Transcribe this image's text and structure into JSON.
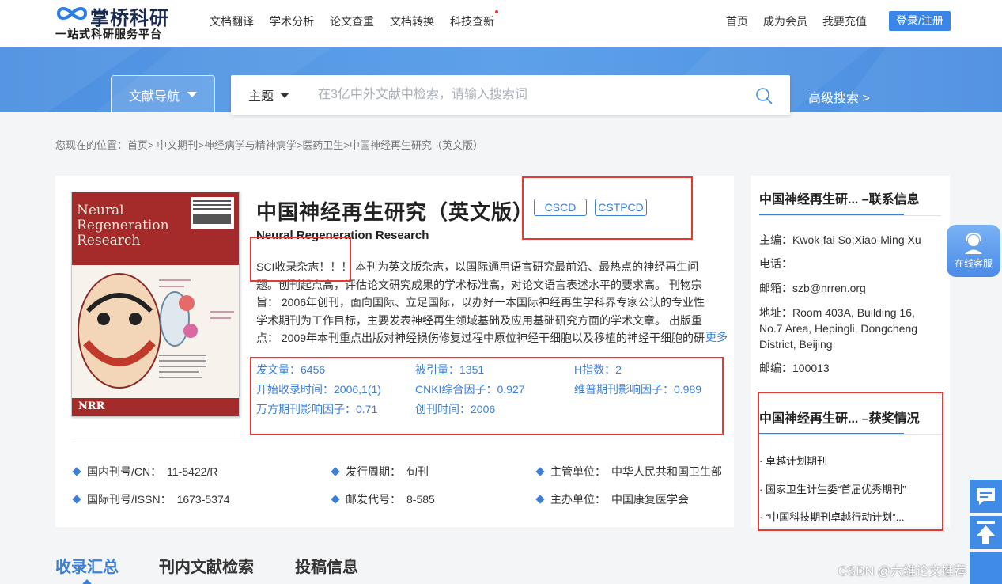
{
  "header": {
    "logo_name": "掌桥科研",
    "logo_slogan": "一站式科研服务平台",
    "nav": [
      "文档翻译",
      "学术分析",
      "论文查重",
      "文档转换",
      "科技查新"
    ],
    "right_nav": [
      "首页",
      "成为会员",
      "我要充值"
    ],
    "login_label": "登录/注册"
  },
  "search": {
    "nav_button": "文献导航",
    "type_label": "主题",
    "placeholder": "在3亿中外文献中检索，请输入搜索词",
    "advanced_label": "高级搜索 >"
  },
  "breadcrumb": "您现在的位置：首页> 中文期刊>神经病学与精神病学>医药卫生>中国神经再生研究（英文版）",
  "journal": {
    "title": "中国神经再生研究（英文版）",
    "tags": [
      "CSCD",
      "CSTPCD"
    ],
    "english_title": "Neural Regeneration Research",
    "description": "SCI收录杂志！！！ 本刊为英文版杂志，以国际通用语言研究最前沿、最热点的神经再生问题。创刊起点高，评估论文研究成果的学术标准高，对论文语言表述水平的要求高。 刊物宗旨： 2006年创刊，面向国际、立足国际，以办好一本国际神经再生学科界专家公认的专业性学术期刊为工作目标，主要发表神经再生领域基础及应用基础研究方面的学术文章。 出版重点： 2009年本刊重点出版对神经损伤修复过程中原位神经干细胞以及移植的神经干细胞的研究",
    "more_label": "更多",
    "cover": {
      "title_lines": [
        "Neural",
        "Regeneration",
        "Research"
      ],
      "abbr": "NRR"
    },
    "stats": [
      {
        "label": "发文量：",
        "value": "6456"
      },
      {
        "label": "被引量：",
        "value": "1351"
      },
      {
        "label": "H指数：",
        "value": "2"
      },
      {
        "label": "开始收录时间：",
        "value": "2006,1(1)"
      },
      {
        "label": "CNKI综合因子：",
        "value": "0.927"
      },
      {
        "label": "维普期刊影响因子：",
        "value": "0.989"
      },
      {
        "label": "万方期刊影响因子：",
        "value": "0.71"
      },
      {
        "label": "创刊时间：",
        "value": "2006"
      }
    ],
    "meta": [
      {
        "label": "国内刊号/CN：",
        "value": "11-5422/R"
      },
      {
        "label": "发行周期：",
        "value": "旬刊"
      },
      {
        "label": "主管单位：",
        "value": "中华人民共和国卫生部"
      },
      {
        "label": "国际刊号/ISSN：",
        "value": "1673-5374"
      },
      {
        "label": "邮发代号：",
        "value": "8-585"
      },
      {
        "label": "主办单位：",
        "value": "中国康复医学会"
      }
    ]
  },
  "sidebar": {
    "contact_heading": "中国神经再生研... –联系信息",
    "contact": [
      {
        "label": "主编：",
        "value": "Kwok-fai So;Xiao-Ming Xu"
      },
      {
        "label": "电话：",
        "value": ""
      },
      {
        "label": "邮箱：",
        "value": "szb@nrren.org"
      },
      {
        "label": "地址：",
        "value": "Room 403A, Building 16, No.7 Area, Hepingli, Dongcheng District, Beijing"
      },
      {
        "label": "邮编：",
        "value": "100013"
      }
    ],
    "awards_heading": "中国神经再生研... –获奖情况",
    "awards": [
      "卓越计划期刊",
      "国家卫生计生委“首届优秀期刊”",
      "“中国科技期刊卓越行动计划”..."
    ]
  },
  "tabs": [
    "收录汇总",
    "刊内文献检索",
    "投稿信息"
  ],
  "service_label": "在线客服",
  "watermark": "CSDN @六维论文推荐",
  "colors": {
    "accent": "#3d7fd6",
    "banner": "#5a9be8",
    "annotation": "#e53935"
  }
}
